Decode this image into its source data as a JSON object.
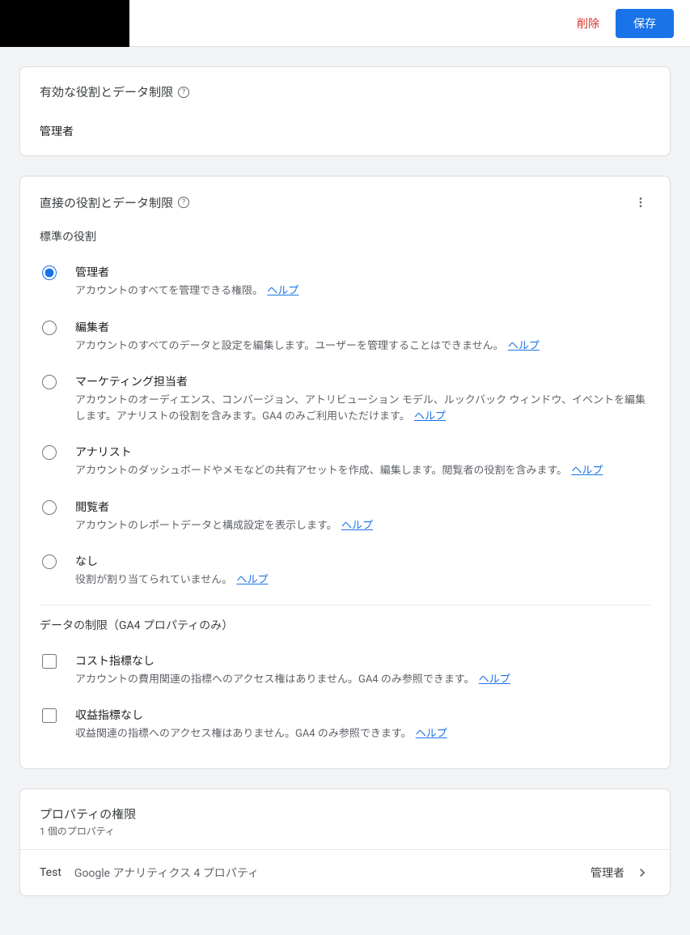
{
  "header": {
    "delete": "削除",
    "save": "保存"
  },
  "effective": {
    "title": "有効な役割とデータ制限",
    "role": "管理者"
  },
  "direct": {
    "title": "直接の役割とデータ制限",
    "standardLabel": "標準の役割",
    "roles": [
      {
        "name": "管理者",
        "desc": "アカウントのすべてを管理できる権限。",
        "help": "ヘルプ",
        "selected": true
      },
      {
        "name": "編集者",
        "desc": "アカウントのすべてのデータと設定を編集します。ユーザーを管理することはできません。",
        "help": "ヘルプ",
        "selected": false
      },
      {
        "name": "マーケティング担当者",
        "desc": "アカウントのオーディエンス、コンバージョン、アトリビューション モデル、ルックバック ウィンドウ、イベントを編集します。アナリストの役割を含みます。GA4 のみご利用いただけます。",
        "help": "ヘルプ",
        "selected": false
      },
      {
        "name": "アナリスト",
        "desc": "アカウントのダッシュボードやメモなどの共有アセットを作成、編集します。閲覧者の役割を含みます。",
        "help": "ヘルプ",
        "selected": false
      },
      {
        "name": "閲覧者",
        "desc": "アカウントのレポートデータと構成設定を表示します。",
        "help": "ヘルプ",
        "selected": false
      },
      {
        "name": "なし",
        "desc": "役割が割り当てられていません。",
        "help": "ヘルプ",
        "selected": false
      }
    ],
    "restrictionsLabel": "データの制限（GA4 プロパティのみ）",
    "restrictions": [
      {
        "name": "コスト指標なし",
        "desc": "アカウントの費用関連の指標へのアクセス権はありません。GA4 のみ参照できます。",
        "help": "ヘルプ"
      },
      {
        "name": "収益指標なし",
        "desc": "収益関連の指標へのアクセス権はありません。GA4 のみ参照できます。",
        "help": "ヘルプ"
      }
    ]
  },
  "properties": {
    "title": "プロパティの権限",
    "count": "1 個のプロパティ",
    "items": [
      {
        "name": "Test",
        "type": "Google アナリティクス 4 プロパティ",
        "role": "管理者"
      }
    ]
  }
}
